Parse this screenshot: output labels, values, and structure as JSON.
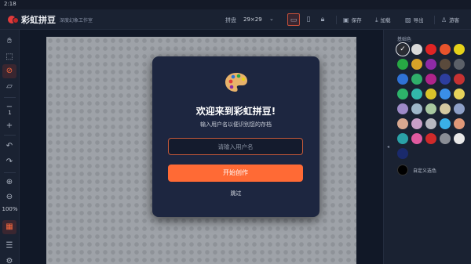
{
  "status": {
    "time": "2:18"
  },
  "header": {
    "title": "彩虹拼豆",
    "subtitle": "深度幻象工作室",
    "board_label": "拼盘",
    "board_size": "29×29",
    "buttons": {
      "save": "保存",
      "load": "加载",
      "export": "导出",
      "guest": "游客"
    }
  },
  "left_toolbar": {
    "layer_number": "1",
    "zoom": "100%"
  },
  "palette": {
    "title": "基础色",
    "colors": [
      "#2b2d33",
      "#d9d9d9",
      "#e02424",
      "#e8542c",
      "#e6d21a",
      "#27a844",
      "#d8a228",
      "#8e2aa6",
      "#5a4a3c",
      "#5b6068",
      "#2f72d6",
      "#2fae6a",
      "#b0248a",
      "#2d3e9e",
      "#c63232",
      "#2db36a",
      "#32b8aa",
      "#d9c32a",
      "#3a8ee6",
      "#e6d25a",
      "#9e8ac8",
      "#9fb7c9",
      "#a8c8a0",
      "#d4c8a0",
      "#8ea0c8",
      "#d8a890",
      "#c8a0c8",
      "#b8b8c0",
      "#3ab0e8",
      "#e09878",
      "#2aa2a8",
      "#e05aa0",
      "#d02a2a",
      "#8a8e96",
      "#e8e8e8",
      "#1a2a6c"
    ],
    "selected_index": 0,
    "custom_label": "自定义选色",
    "custom_color": "#000000"
  },
  "modal": {
    "title": "欢迎来到彩虹拼豆!",
    "subtitle": "输入用户名以便识别您的存档",
    "input_placeholder": "请输入用户名",
    "input_value": "",
    "start_button": "开始创作",
    "skip": "跳过"
  }
}
